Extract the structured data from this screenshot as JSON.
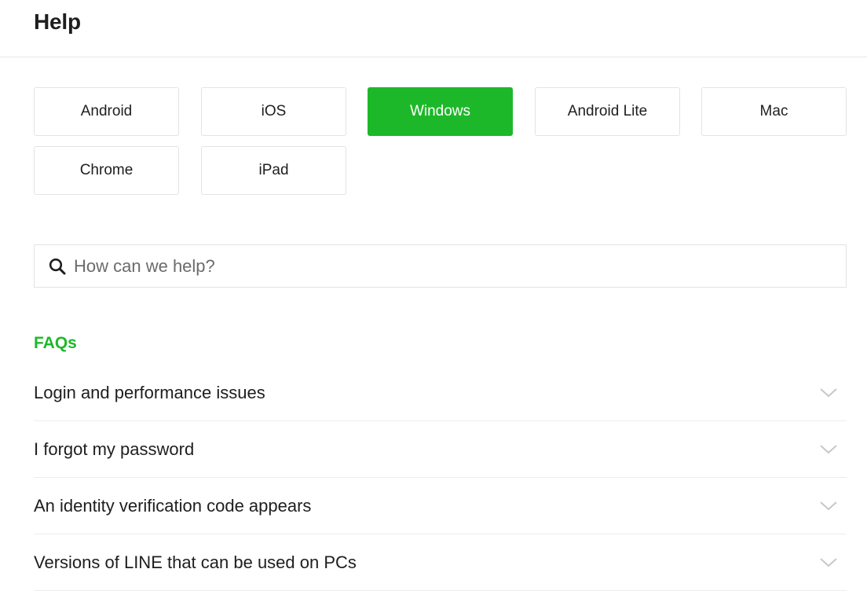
{
  "header": {
    "title": "Help"
  },
  "platforms": {
    "selected": "Windows",
    "accent_color": "#1db829",
    "items": [
      {
        "label": "Android",
        "active": false
      },
      {
        "label": "iOS",
        "active": false
      },
      {
        "label": "Windows",
        "active": true
      },
      {
        "label": "Android Lite",
        "active": false
      },
      {
        "label": "Mac",
        "active": false
      },
      {
        "label": "Chrome",
        "active": false
      },
      {
        "label": "iPad",
        "active": false
      }
    ]
  },
  "search": {
    "icon": "search-icon",
    "placeholder": "How can we help?",
    "value": ""
  },
  "faqs": {
    "title": "FAQs",
    "items": [
      {
        "label": "Login and performance issues",
        "icon": "chevron-down-icon"
      },
      {
        "label": "I forgot my password",
        "icon": "chevron-down-icon"
      },
      {
        "label": "An identity verification code appears",
        "icon": "chevron-down-icon"
      },
      {
        "label": "Versions of LINE that can be used on PCs",
        "icon": "chevron-down-icon"
      }
    ]
  }
}
